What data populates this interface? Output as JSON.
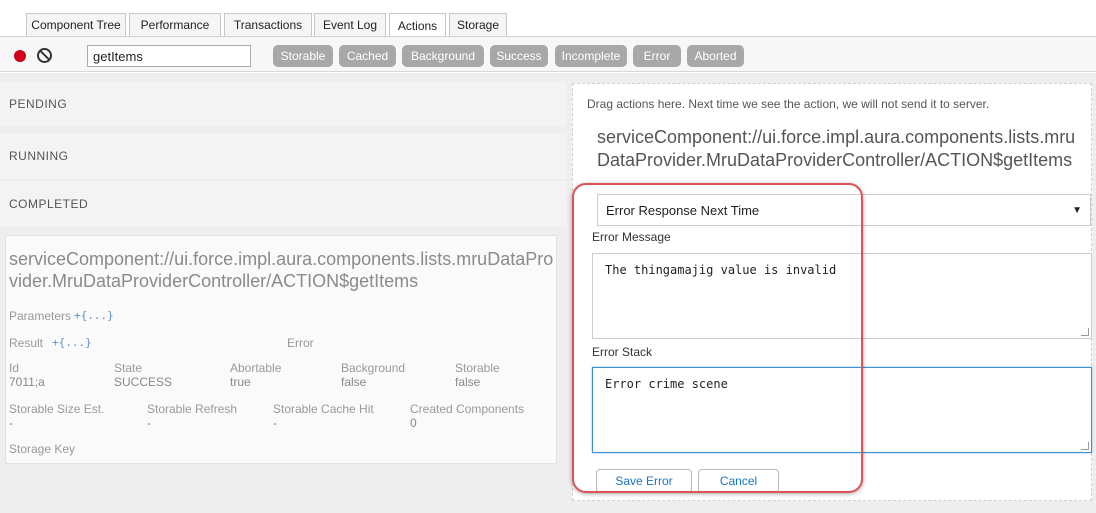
{
  "tabs": [
    {
      "label": "Component Tree"
    },
    {
      "label": "Performance"
    },
    {
      "label": "Transactions"
    },
    {
      "label": "Event Log"
    },
    {
      "label": "Actions",
      "active": true
    },
    {
      "label": "Storage"
    }
  ],
  "toolbar": {
    "record_icon": "record-icon",
    "clear_icon": "clear-icon",
    "filter_value": "getItems",
    "chips": [
      "Storable",
      "Cached",
      "Background",
      "Success",
      "Incomplete",
      "Error",
      "Aborted"
    ]
  },
  "sections": {
    "pending": "PENDING",
    "running": "RUNNING",
    "completed": "COMPLETED"
  },
  "action": {
    "name": "serviceComponent://ui.force.impl.aura.components.lists.mruDataProvider.MruDataProviderController/ACTION$getItems",
    "parameters_label": "Parameters",
    "parameters_toggle": "+{...}",
    "result_label": "Result",
    "result_toggle": "+{...}",
    "error_label": "Error",
    "id_label": "Id",
    "id_value": "7011;a",
    "state_label": "State",
    "state_value": "SUCCESS",
    "abortable_label": "Abortable",
    "abortable_value": "true",
    "background_label": "Background",
    "background_value": "false",
    "storable_label": "Storable",
    "storable_value": "false",
    "size_label": "Storable Size Est.",
    "size_value": "-",
    "refresh_label": "Storable Refresh",
    "refresh_value": "-",
    "cachehit_label": "Storable Cache Hit",
    "cachehit_value": "-",
    "created_label": "Created Components",
    "created_value": "0",
    "storagekey_label": "Storage Key"
  },
  "override": {
    "hint": "Drag actions here. Next time we see the action, we will not send it to server.",
    "name": "serviceComponent://ui.force.impl.aura.components.lists.mruDataProvider.MruDataProviderController/ACTION$getItems",
    "mode": "Error Response Next Time",
    "error_message_label": "Error Message",
    "error_message_value": "The thingamajig value is invalid",
    "error_stack_label": "Error Stack",
    "error_stack_value": "Error crime scene",
    "save_label": "Save Error",
    "cancel_label": "Cancel"
  },
  "colors": {
    "record": "#d0021b",
    "highlight": "#de5456",
    "focus": "#3d8fd8",
    "link": "#1a73c7"
  }
}
